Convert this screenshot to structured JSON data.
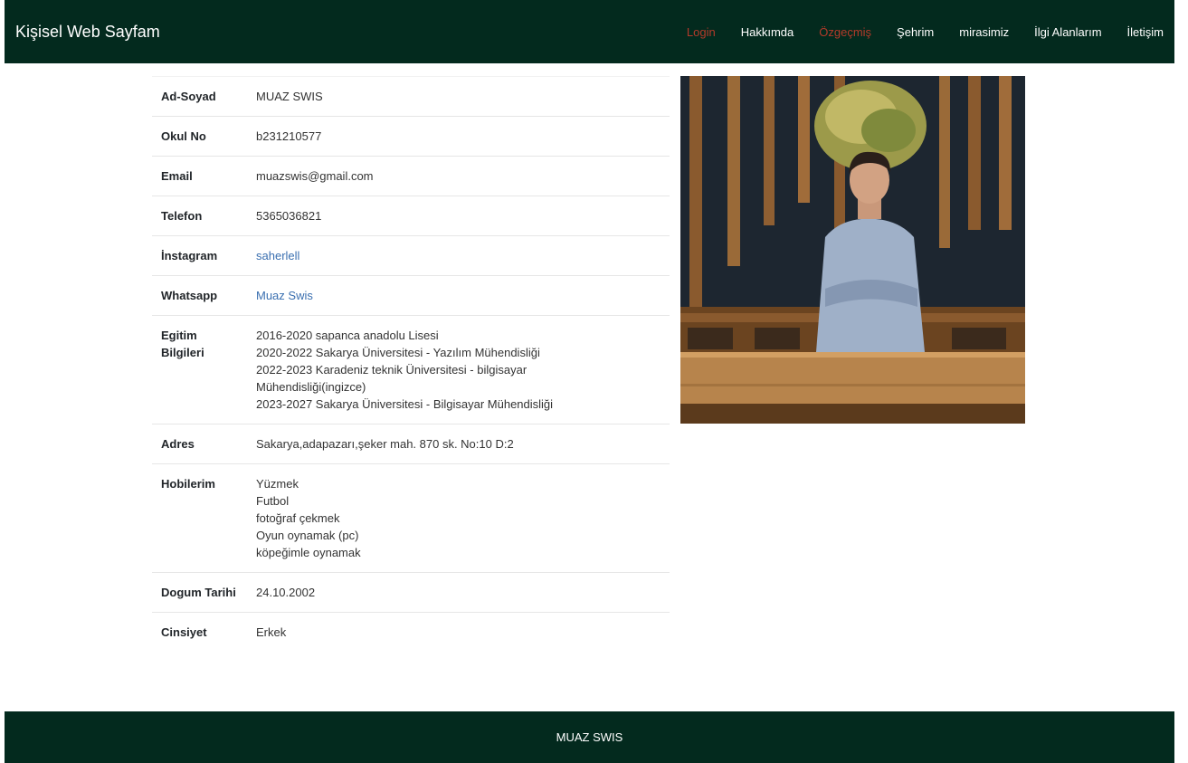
{
  "navbar": {
    "brand": "Kişisel Web Sayfam",
    "links": [
      {
        "label": "Login"
      },
      {
        "label": "Hakkımda"
      },
      {
        "label": "Özgeçmiş"
      },
      {
        "label": "Şehrim"
      },
      {
        "label": "mirasimiz"
      },
      {
        "label": "İlgi Alanlarım"
      },
      {
        "label": "İletişim"
      }
    ]
  },
  "profile": {
    "ad_soyad": {
      "label": "Ad-Soyad",
      "value": "MUAZ SWIS"
    },
    "okul_no": {
      "label": "Okul No",
      "value": "b231210577"
    },
    "email": {
      "label": "Email",
      "value": "muazswis@gmail.com"
    },
    "telefon": {
      "label": "Telefon",
      "value": "5365036821"
    },
    "instagram": {
      "label": "İnstagram",
      "value": "saherlell"
    },
    "whatsapp": {
      "label": "Whatsapp",
      "value": "Muaz Swis"
    },
    "egitim": {
      "label_line1": "Egitim",
      "label_line2": "Bilgileri",
      "lines": [
        "2016-2020 sapanca anadolu Lisesi",
        "2020-2022 Sakarya Üniversitesi - Yazılım Mühendisliği",
        "2022-2023 Karadeniz teknik Üniversitesi - bilgisayar",
        "Mühendisliği(ingizce)",
        "2023-2027 Sakarya Üniversitesi - Bilgisayar Mühendisliği"
      ]
    },
    "adres": {
      "label": "Adres",
      "value": "Sakarya,adapazarı,şeker mah. 870 sk. No:10 D:2"
    },
    "hobiler": {
      "label": "Hobilerim",
      "items": [
        "Yüzmek",
        "Futbol",
        "fotoğraf çekmek",
        "Oyun oynamak (pc)",
        "köpeğimle oynamak"
      ]
    },
    "dogum_tarihi": {
      "label": "Dogum Tarihi",
      "value": "24.10.2002"
    },
    "cinsiyet": {
      "label": "Cinsiyet",
      "value": "Erkek"
    }
  },
  "colors": {
    "nav_bg": "#032a1e",
    "accent": "#b33a2a",
    "link": "#3a6fb0"
  },
  "footer": {
    "text": "MUAZ SWIS"
  }
}
